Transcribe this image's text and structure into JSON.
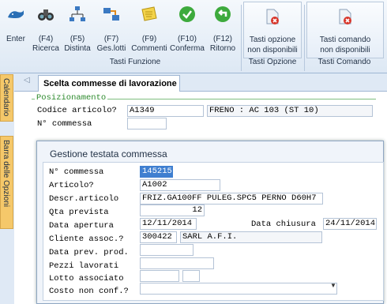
{
  "ribbon": {
    "buttons": [
      {
        "label1": "Enter",
        "label2": ""
      },
      {
        "label1": "(F4)",
        "label2": "Ricerca"
      },
      {
        "label1": "(F5)",
        "label2": "Distinta"
      },
      {
        "label1": "(F7)",
        "label2": "Ges.lotti"
      },
      {
        "label1": "(F9)",
        "label2": "Commenti"
      },
      {
        "label1": "(F10)",
        "label2": "Conferma"
      },
      {
        "label1": "(F12)",
        "label2": "Ritorno"
      }
    ],
    "group_caption": "Tasti Funzione",
    "option_button": {
      "label1": "Tasti opzione",
      "label2": "non disponibili",
      "caption": "Tasti Opzione"
    },
    "command_button": {
      "label1": "Tasti comando",
      "label2": "non disponibili",
      "caption": "Tasti Comando"
    }
  },
  "side_tabs": {
    "calendar": "Calendario",
    "options": "Barra delle Opzioni"
  },
  "tab": {
    "label": "Scelta commesse di lavorazione",
    "back_arrow": "◁"
  },
  "positioning": {
    "legend": "Posizionamento",
    "codice_label": "Codice articolo?",
    "codice_value": "A1349",
    "codice_desc": "FRENO : AC 103 (ST 10)",
    "commessa_label": "N° commessa",
    "commessa_value": ""
  },
  "dialog": {
    "title": "Gestione testata commessa",
    "fields": {
      "n_commessa_label": "N° commessa",
      "n_commessa_value": "145215",
      "articolo_label": "Articolo?",
      "articolo_value": "A1002",
      "descr_label": "Descr.articolo",
      "descr_value": "FRIZ.GA100FF PULEG.SPC5 PERNO D60H7",
      "qta_label": "Qta prevista",
      "qta_value": "12",
      "data_apertura_label": "Data apertura",
      "data_apertura_value": "12/11/2014",
      "data_chiusura_label": "Data chiusura",
      "data_chiusura_value": "24/11/2014",
      "cliente_label": "Cliente assoc.?",
      "cliente_code": "300422",
      "cliente_name": "SARL A.F.I.",
      "data_prev_label": "Data prev. prod.",
      "data_prev_value": "",
      "pezzi_label": "Pezzi lavorati",
      "pezzi_value": "",
      "lotto_label": "Lotto associato",
      "lotto_value1": "",
      "lotto_value2": "",
      "costo_label": "Costo non conf.?",
      "costo_value": ""
    }
  }
}
